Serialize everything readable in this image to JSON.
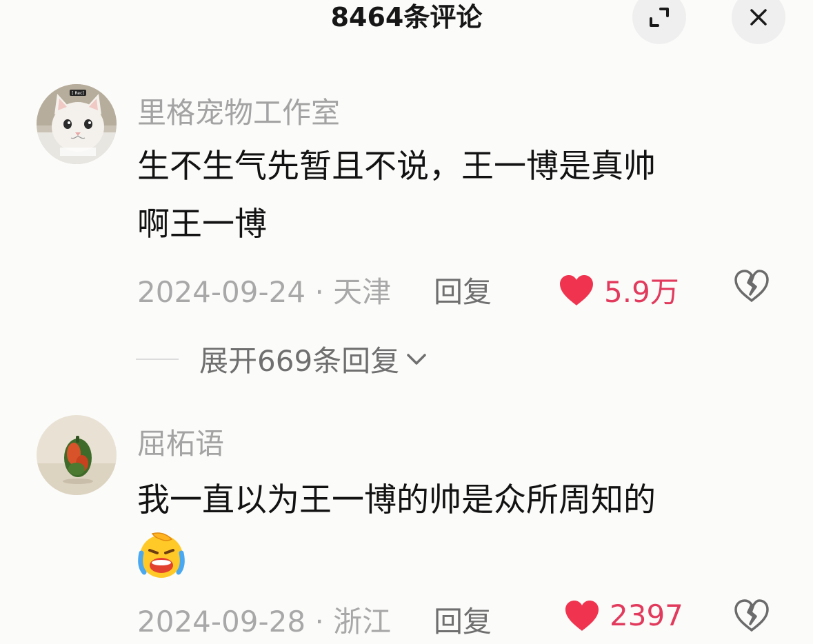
{
  "header": {
    "title": "8464条评论"
  },
  "comments": [
    {
      "username": "里格宠物工作室",
      "text_line1": "生不生气先暂且不说，王一博是真帅",
      "text_line2": "啊王一博",
      "date": "2024-09-24",
      "location": "天津",
      "separator": " · ",
      "reply_label": "回复",
      "likes": "5.9万",
      "expand_replies": "展开669条回复",
      "avatar_badge": "[ Rec]"
    },
    {
      "username": "屈柘语",
      "text_line1": "我一直以为王一博的帅是众所周知的",
      "date": "2024-09-28",
      "location": "浙江",
      "separator": " · ",
      "reply_label": "回复",
      "likes": "2397"
    }
  ],
  "colors": {
    "like_red": "#e23a5c",
    "meta_gray": "#a8a8a8",
    "background": "#fbfbfa"
  },
  "icons": {
    "expand": "expand-icon",
    "close": "close-icon",
    "like": "heart-icon",
    "dislike": "broken-heart-icon",
    "chevron": "chevron-down-icon",
    "emoji": "laughing-crying-emoji"
  }
}
